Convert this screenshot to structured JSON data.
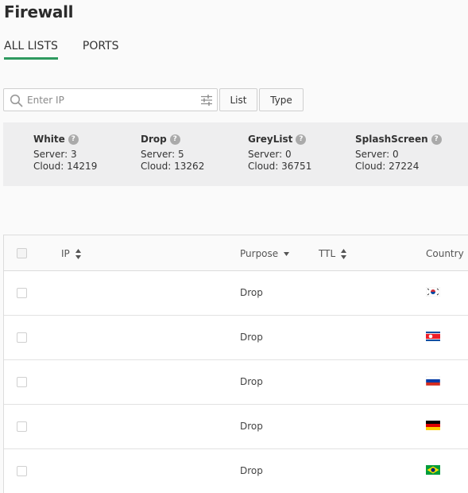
{
  "page": {
    "title": "Firewall"
  },
  "tabs": [
    {
      "label": "ALL LISTS",
      "active": true
    },
    {
      "label": "PORTS",
      "active": false
    }
  ],
  "toolbar": {
    "search_placeholder": "Enter IP",
    "list_button": "List",
    "type_button": "Type"
  },
  "stats": [
    {
      "name": "White",
      "server_label": "Server:",
      "server": "3",
      "cloud_label": "Cloud:",
      "cloud": "14219"
    },
    {
      "name": "Drop",
      "server_label": "Server:",
      "server": "5",
      "cloud_label": "Cloud:",
      "cloud": "13262"
    },
    {
      "name": "GreyList",
      "server_label": "Server:",
      "server": "0",
      "cloud_label": "Cloud:",
      "cloud": "36751"
    },
    {
      "name": "SplashScreen",
      "server_label": "Server:",
      "server": "0",
      "cloud_label": "Cloud:",
      "cloud": "27224"
    }
  ],
  "table": {
    "columns": {
      "ip": "IP",
      "purpose": "Purpose",
      "ttl": "TTL",
      "country": "Country"
    },
    "rows": [
      {
        "ip": "",
        "purpose": "Drop",
        "ttl": "",
        "country_flag": "south-korea-flag"
      },
      {
        "ip": "",
        "purpose": "Drop",
        "ttl": "",
        "country_flag": "north-korea-flag"
      },
      {
        "ip": "",
        "purpose": "Drop",
        "ttl": "",
        "country_flag": "russia-flag"
      },
      {
        "ip": "",
        "purpose": "Drop",
        "ttl": "",
        "country_flag": "germany-flag"
      },
      {
        "ip": "",
        "purpose": "Drop",
        "ttl": "",
        "country_flag": "brazil-flag"
      }
    ]
  },
  "colors": {
    "accent": "#2e9a5f",
    "stats_bg": "#eeeeef",
    "help_icon": "#aaaaaa"
  }
}
